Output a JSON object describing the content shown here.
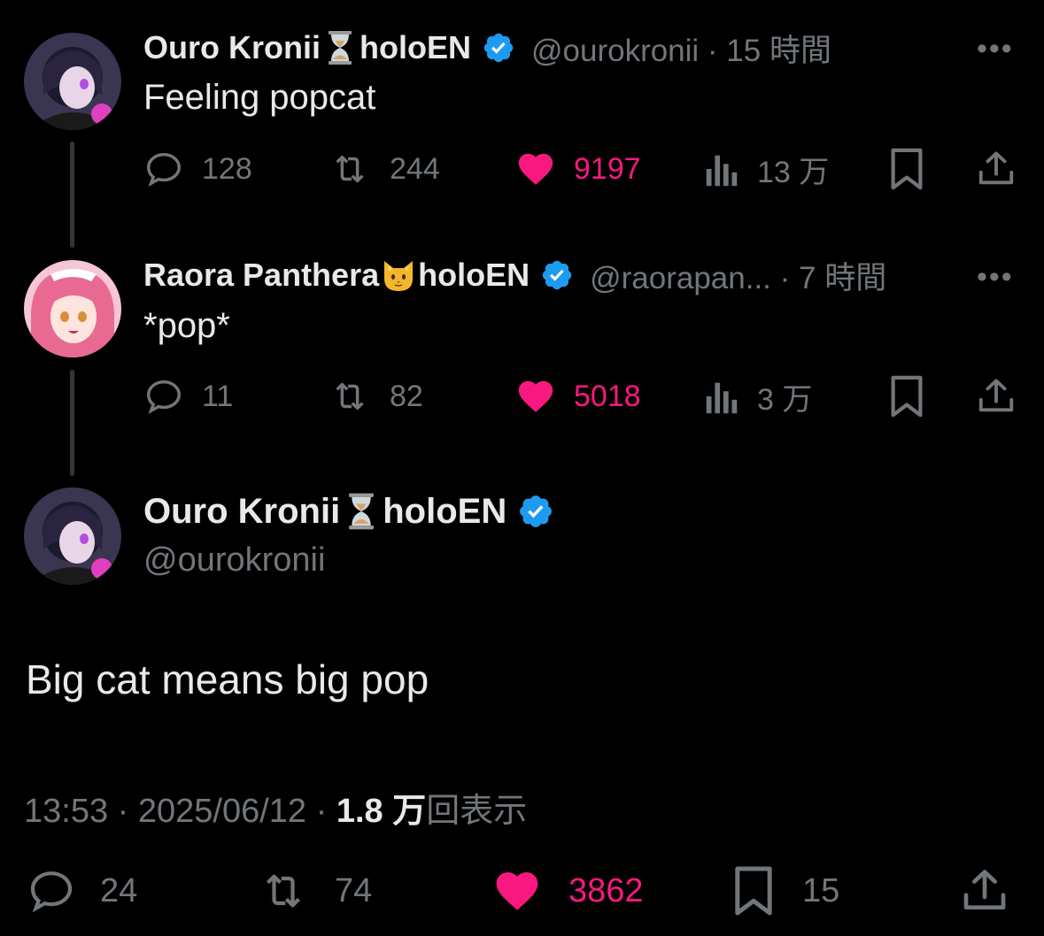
{
  "colors": {
    "background": "#000000",
    "text": "#e7e9ea",
    "muted": "#71767b",
    "like": "#f91880",
    "verified": "#1d9bf0"
  },
  "tweets": [
    {
      "name": "Ouro Kronii",
      "name_suffix": "holoEN",
      "emoji": "hourglass-icon",
      "handle": "@ourokronii · 15 時間",
      "text": "Feeling popcat",
      "more": "•••",
      "replies": "128",
      "retweets": "244",
      "likes": "9197",
      "views": "13 万"
    },
    {
      "name": "Raora Panthera",
      "name_suffix": "holoEN",
      "emoji": "cat-face-icon",
      "handle": "@raorapan... · 7 時間",
      "text": "*pop*",
      "more": "•••",
      "replies": "11",
      "retweets": "82",
      "likes": "5018",
      "views": "3 万"
    }
  ],
  "main": {
    "name": "Ouro Kronii",
    "name_suffix": "holoEN",
    "handle": "@ourokronii",
    "text": "Big cat means big pop",
    "time": "13:53 · 2025/06/12 · ",
    "views_count": "1.8 万",
    "views_label": "回表示",
    "replies": "24",
    "retweets": "74",
    "likes": "3862",
    "bookmarks": "15"
  }
}
